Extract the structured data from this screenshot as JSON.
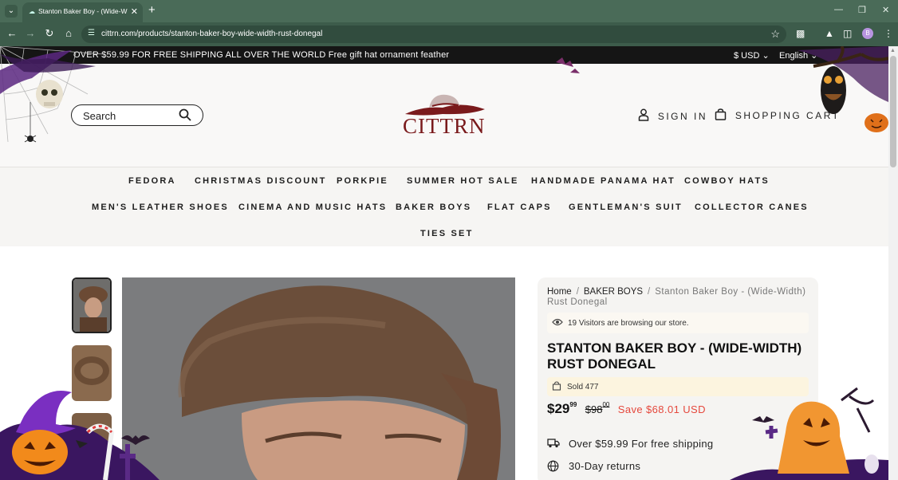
{
  "browser": {
    "tab_title": "Stanton Baker Boy - (Wide-Wi",
    "url": "cittrn.com/products/stanton-baker-boy-wide-width-rust-donegal",
    "profile_initial": "B"
  },
  "announcement": {
    "message": "OVER $59.99 FOR FREE SHIPPING ALL OVER THE WORLD Free gift hat ornament feather",
    "currency": "$ USD",
    "language": "English"
  },
  "header": {
    "search_placeholder": "Search",
    "logo_text": "CITTRN",
    "sign_in": "SIGN IN",
    "cart": "SHOPPING CART"
  },
  "nav": {
    "row1": [
      "FEDORA",
      "CHRISTMAS DISCOUNT",
      "PORKPIE",
      "SUMMER HOT SALE",
      "HANDMADE PANAMA HAT",
      "COWBOY HATS"
    ],
    "row2": [
      "MEN'S LEATHER SHOES",
      "CINEMA AND MUSIC HATS",
      "BAKER BOYS",
      "FLAT CAPS",
      "GENTLEMAN'S SUIT",
      "COLLECTOR CANES"
    ],
    "row3": [
      "TIES SET"
    ]
  },
  "breadcrumb": {
    "home": "Home",
    "category": "BAKER BOYS",
    "current": "Stanton Baker Boy - (Wide-Width) Rust Donegal"
  },
  "product": {
    "visitors": "19 Visitors are browsing our store.",
    "title": "STANTON BAKER BOY - (WIDE-WIDTH) RUST DONEGAL",
    "sold": "Sold 477",
    "price_main": "$29",
    "price_cents": "99",
    "compare_main": "$98",
    "compare_cents": "00",
    "save": "Save $68.01 USD",
    "perk_shipping": "Over $59.99 For free shipping",
    "perk_returns": "30-Day returns"
  },
  "colors": {
    "chrome": "#4a6b58",
    "toolbar": "#3d5c4b",
    "announcement_bg": "#151515",
    "logo": "#7a1a1c",
    "sale": "#e5483d"
  }
}
